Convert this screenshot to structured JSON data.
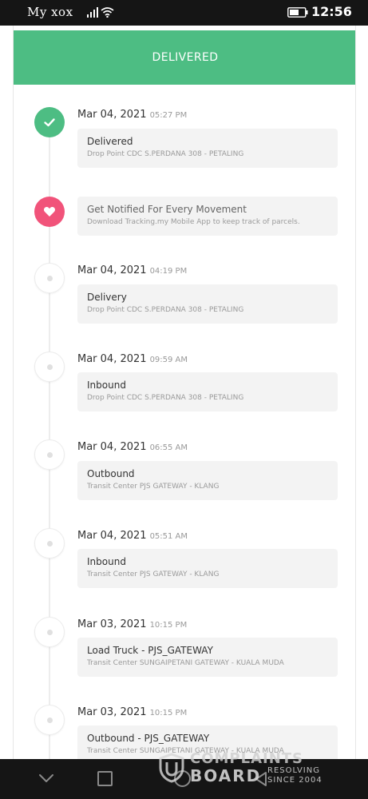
{
  "status_bar": {
    "carrier": "My xox",
    "clock": "12:56"
  },
  "header": {
    "status": "DELIVERED"
  },
  "notice": {
    "title": "Get Notified For Every Movement",
    "subtitle": "Download Tracking.my Mobile App to keep track of parcels."
  },
  "events": [
    {
      "date": "Mar 04, 2021",
      "time": "05:27 PM",
      "title": "Delivered",
      "location": "Drop Point CDC S.PERDANA 308 - PETALING"
    },
    {
      "date": "Mar 04, 2021",
      "time": "04:19 PM",
      "title": "Delivery",
      "location": "Drop Point CDC S.PERDANA 308 - PETALING"
    },
    {
      "date": "Mar 04, 2021",
      "time": "09:59 AM",
      "title": "Inbound",
      "location": "Drop Point CDC S.PERDANA 308 - PETALING"
    },
    {
      "date": "Mar 04, 2021",
      "time": "06:55 AM",
      "title": "Outbound",
      "location": "Transit Center PJS GATEWAY - KLANG"
    },
    {
      "date": "Mar 04, 2021",
      "time": "05:51 AM",
      "title": "Inbound",
      "location": "Transit Center PJS GATEWAY - KLANG"
    },
    {
      "date": "Mar 03, 2021",
      "time": "10:15 PM",
      "title": "Load Truck - PJS_GATEWAY",
      "location": "Transit Center SUNGAIPETANI GATEWAY - KUALA MUDA"
    },
    {
      "date": "Mar 03, 2021",
      "time": "10:15 PM",
      "title": "Outbound - PJS_GATEWAY",
      "location": "Transit Center SUNGAIPETANI GATEWAY - KUALA MUDA"
    }
  ],
  "watermark": {
    "line1": "COMPLAINTS",
    "line2": "BOARD",
    "tag1": "RESOLVING",
    "tag2": "SINCE 2004"
  },
  "colors": {
    "accent_green": "#4dbd83",
    "notify_pink": "#f1537a",
    "system_bar": "#151515"
  },
  "icons": {
    "status": [
      "signal-icon",
      "wifi-icon",
      "battery-icon"
    ],
    "timeline": [
      "check-icon",
      "heart-icon",
      "dot-icon"
    ],
    "nav": [
      "back-chevron-icon",
      "square-icon",
      "circle-icon",
      "triangle-icon"
    ]
  }
}
